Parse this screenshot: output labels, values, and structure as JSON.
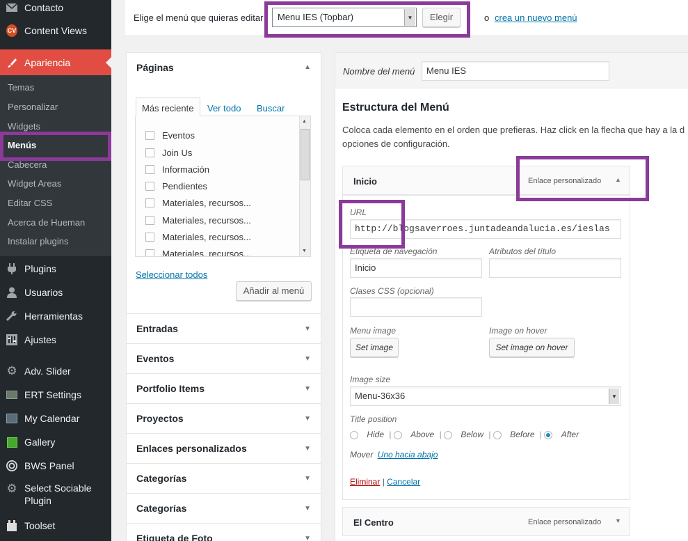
{
  "sidebar": {
    "top_items": [
      {
        "label": "Contacto",
        "icon": "envelope-icon"
      },
      {
        "label": "Content Views",
        "icon": "cv-icon"
      }
    ],
    "active": {
      "label": "Apariencia",
      "icon": "brush-icon"
    },
    "submenu": [
      "Temas",
      "Personalizar",
      "Widgets",
      "Menús",
      "Cabecera",
      "Widget Areas",
      "Editar CSS",
      "Acerca de Hueman",
      "Instalar plugins"
    ],
    "items": [
      {
        "label": "Plugins",
        "icon": "plug-icon"
      },
      {
        "label": "Usuarios",
        "icon": "user-icon"
      },
      {
        "label": "Herramientas",
        "icon": "wrench-icon"
      },
      {
        "label": "Ajustes",
        "icon": "settings-icon"
      },
      {
        "label": "Adv. Slider",
        "icon": "gear-icon"
      },
      {
        "label": "ERT Settings",
        "icon": "image-icon"
      },
      {
        "label": "My Calendar",
        "icon": "calendar-icon"
      },
      {
        "label": "Gallery",
        "icon": "gallery-icon"
      },
      {
        "label": "BWS Panel",
        "icon": "bws-icon"
      },
      {
        "label": "Select Sociable Plugin",
        "icon": "gear-icon"
      },
      {
        "label": "Toolset",
        "icon": "toolset-icon"
      }
    ],
    "cv_badge": "CV"
  },
  "topbar": {
    "label": "Elige el menú que quieras editar",
    "selected_menu": "Menu IES (Topbar)",
    "choose_button": "Elegir",
    "or_text": "o",
    "create_link": "crea un nuevo menú",
    "period": "."
  },
  "left": {
    "pages_title": "Páginas",
    "tabs": [
      "Más reciente",
      "Ver todo",
      "Buscar"
    ],
    "pages": [
      "Eventos",
      "Join Us",
      "Información",
      "Pendientes",
      "Materiales, recursos...",
      "Materiales, recursos...",
      "Materiales, recursos...",
      "Materiales, recursos..."
    ],
    "select_all": "Seleccionar todos",
    "add_button": "Añadir al menú",
    "sections": [
      "Entradas",
      "Eventos",
      "Portfolio Items",
      "Proyectos",
      "Enlaces personalizados",
      "Categorías",
      "Categorías",
      "Etiqueta de Foto"
    ]
  },
  "right": {
    "menu_name_label": "Nombre del menú",
    "menu_name_value": "Menu IES",
    "structure_title": "Estructura del Menú",
    "structure_desc_1": "Coloca cada elemento en el orden que prefieras. Haz click en la flecha que hay a la d",
    "structure_desc_2": "opciones de configuración.",
    "item1": {
      "title": "Inicio",
      "type": "Enlace personalizado",
      "url_label": "URL",
      "url_value": "http://blogsaverroes.juntadeandalucia.es/ieslas",
      "nav_label": "Etiqueta de navegación",
      "nav_value": "Inicio",
      "attr_label": "Atributos del título",
      "attr_value": "",
      "css_label": "Clases CSS (opcional)",
      "css_value": "",
      "menu_image_label": "Menu image",
      "set_image": "Set image",
      "hover_label": "Image on hover",
      "set_hover": "Set image on hover",
      "size_label": "Image size",
      "size_value": "Menu-36x36",
      "title_pos_label": "Title position",
      "positions": [
        "Hide",
        "Above",
        "Below",
        "Before",
        "After"
      ],
      "selected_position": "After",
      "move_label": "Mover",
      "move_link": "Uno hacia abajo",
      "remove": "Eliminar",
      "separator": "|",
      "cancel": "Cancelar"
    },
    "item2": {
      "title": "El Centro",
      "type": "Enlace personalizado"
    }
  },
  "colors": {
    "sidebar_bg": "#23282d",
    "active_bg": "#e14d43",
    "link": "#0073aa",
    "highlight": "#8b3a9a",
    "remove": "#a00"
  }
}
